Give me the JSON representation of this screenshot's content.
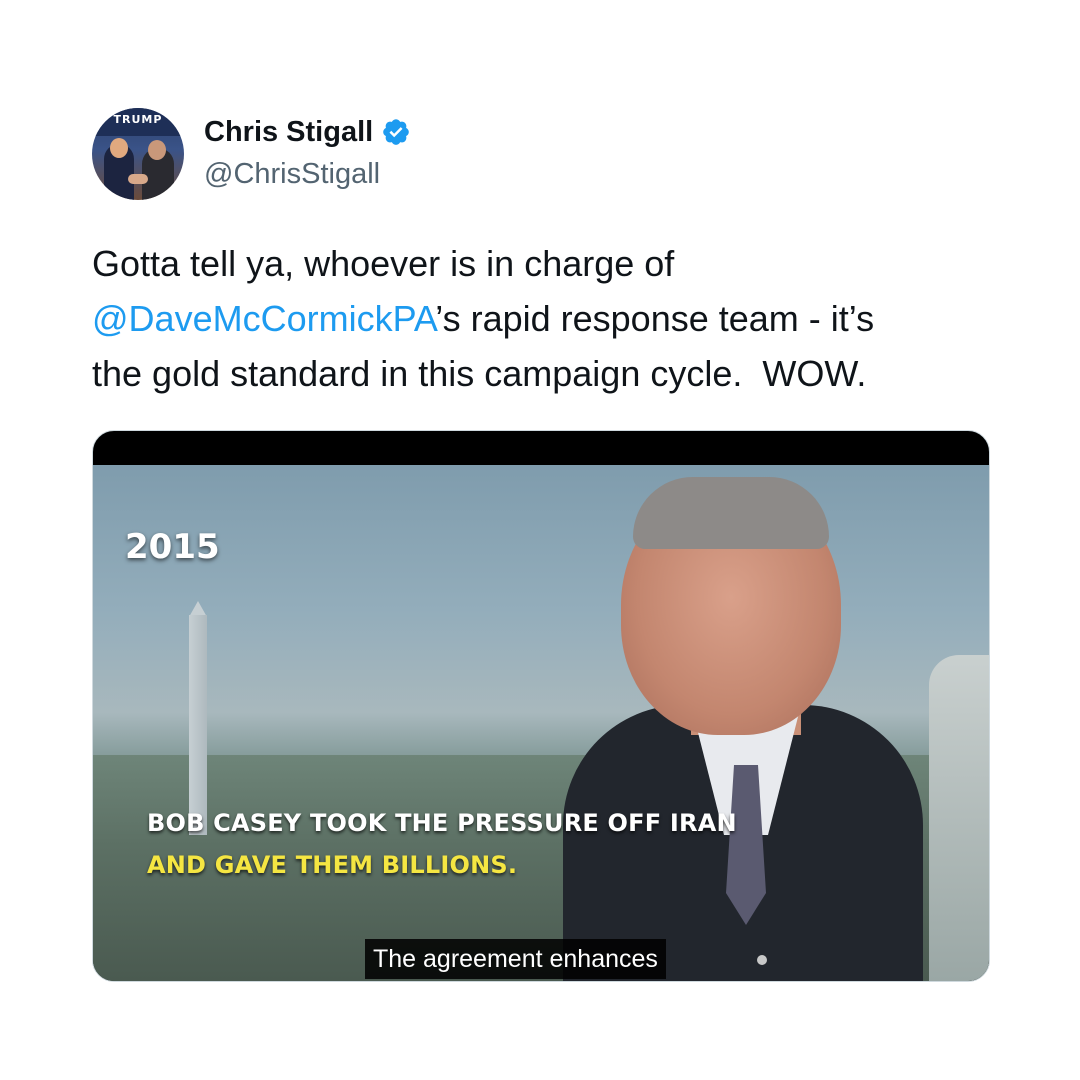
{
  "author": {
    "name": "Chris Stigall",
    "handle": "@ChrisStigall",
    "verified": true,
    "avatar_banner_text": "TRUMP"
  },
  "tweet": {
    "line1": "Gotta tell ya, whoever is in charge of",
    "mention": "@DaveMcCormickPA",
    "line2_rest": "’s rapid response team - it’s",
    "line3": "the gold standard in this campaign cycle.  WOW."
  },
  "media": {
    "year_label": "2015",
    "caption_line1": "BOB CASEY TOOK THE PRESSURE OFF IRAN",
    "caption_line2": "AND GAVE THEM BILLIONS.",
    "subtitle": "The agreement enhances"
  },
  "colors": {
    "link": "#1d9bf0",
    "verified_badge": "#1d9bf0",
    "caption_highlight": "#f5e642"
  }
}
